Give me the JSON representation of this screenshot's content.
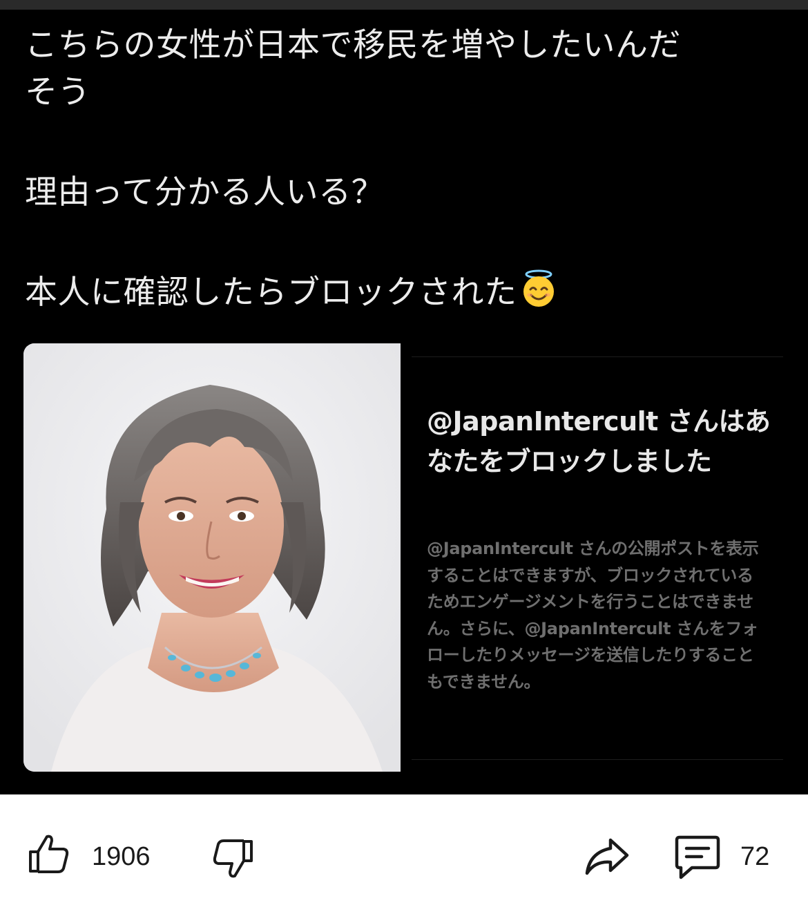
{
  "post": {
    "lines": [
      "こちらの女性が日本で移民を増やしたいんだ",
      "そう",
      "理由って分かる人いる？",
      "本人に確認したらブロックされた"
    ]
  },
  "block_notice": {
    "title": "@JapanIntercult さんはあなたをブロックしました",
    "body": "@JapanIntercult さんの公開ポストを表示することはできますが、ブロックされているためエンゲージメントを行うことはできません。さらに、@JapanIntercult さんをフォローしたりメッセージを送信したりすることもできません。"
  },
  "actions": {
    "like_count": "1906",
    "comment_count": "72"
  },
  "icons": {
    "emoji": "smiling-face-with-halo-icon",
    "like": "thumbs-up-icon",
    "dislike": "thumbs-down-icon",
    "share": "share-arrow-icon",
    "comment": "comment-icon"
  },
  "colors": {
    "post_background": "#000000",
    "post_text": "#ececec",
    "notice_body": "#6f6f6f",
    "action_bar": "#ffffff"
  }
}
